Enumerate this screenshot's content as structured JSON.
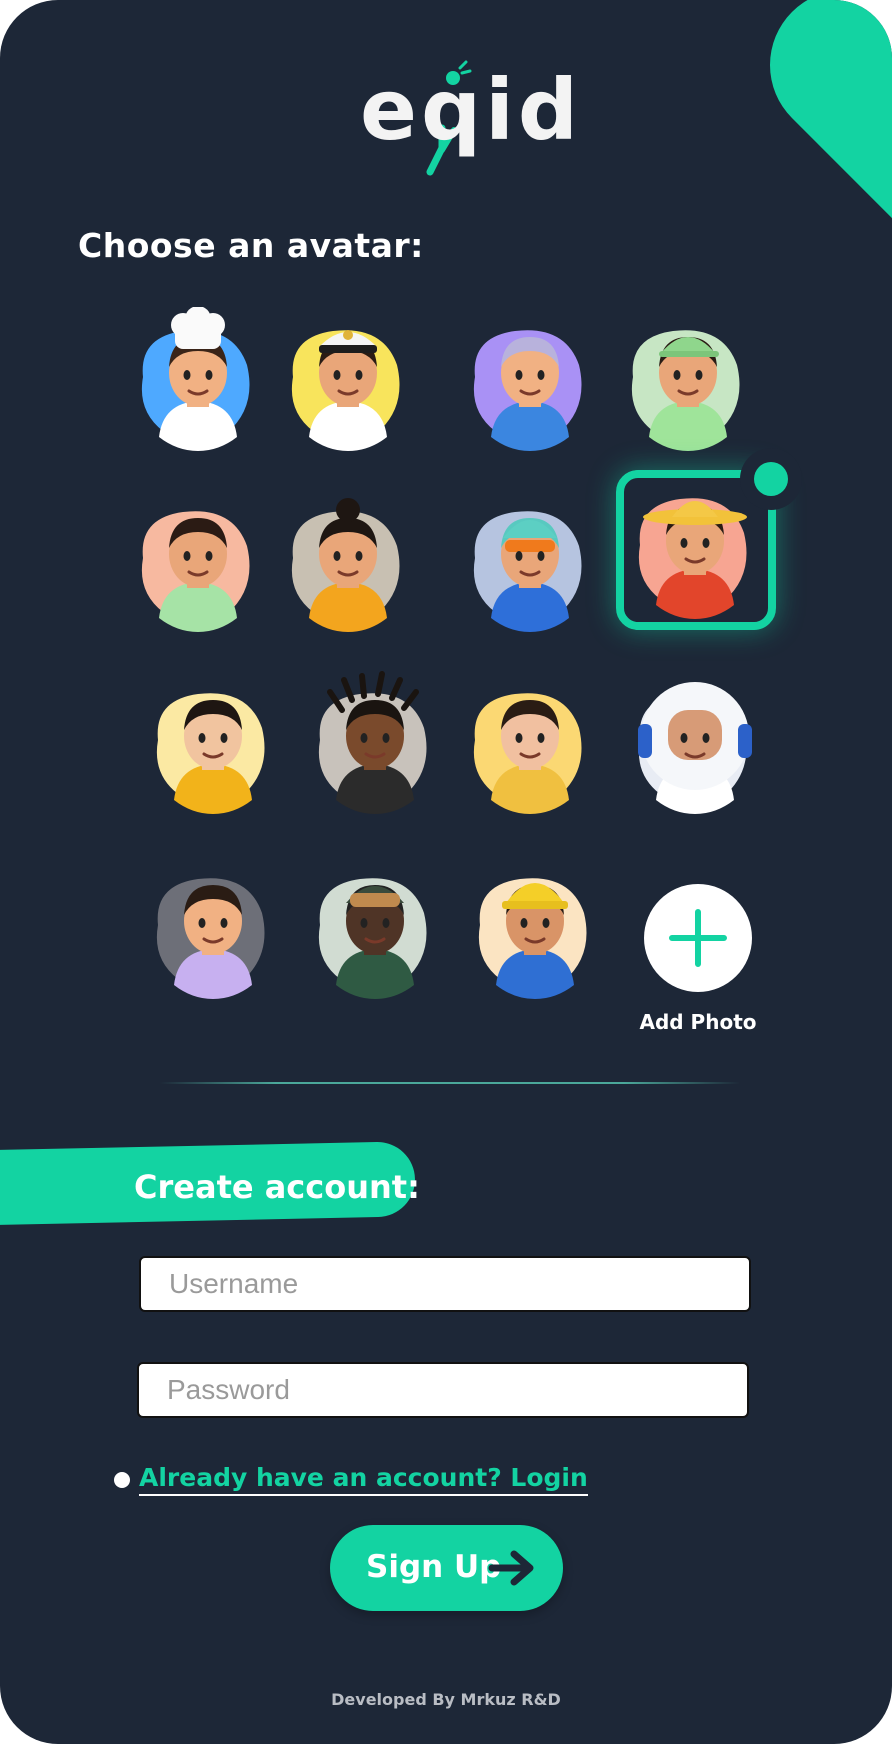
{
  "app": {
    "logo_text": "eqid"
  },
  "avatar_section": {
    "heading": "Choose an avatar:",
    "avatars": [
      {
        "name": "chef",
        "bg": "#4ea9ff",
        "skin": "#f1b183",
        "shirt": "#ffffff",
        "hair": "#3a2418",
        "hat": "chef-hat"
      },
      {
        "name": "pilot",
        "bg": "#f8e45c",
        "skin": "#e9a679",
        "shirt": "#ffffff",
        "hair": "#2a1c14",
        "hat": "captain-cap"
      },
      {
        "name": "doctor",
        "bg": "#a991f5",
        "skin": "#f1b183",
        "shirt": "#3b86e0",
        "hair": "#b8b2dc",
        "hat": "none"
      },
      {
        "name": "coach",
        "bg": "#c7e6c4",
        "skin": "#e9a679",
        "shirt": "#9fe49a",
        "hair": "#2a1c14",
        "hat": "green-cap"
      },
      {
        "name": "boy",
        "bg": "#f7b9a0",
        "skin": "#e9a679",
        "shirt": "#a6e3a6",
        "hair": "#2b1b14",
        "hat": "none"
      },
      {
        "name": "girl",
        "bg": "#c8c0b2",
        "skin": "#e9a679",
        "shirt": "#f3a51e",
        "hair": "#1e1612",
        "hat": "bun"
      },
      {
        "name": "hoodie-guy",
        "bg": "#b6c4e0",
        "skin": "#e9a679",
        "shirt": "#2e6fd9",
        "hair": "#58c9c0",
        "hat": "beanie"
      },
      {
        "name": "farmer",
        "bg": "#f7a592",
        "skin": "#e9a679",
        "shirt": "#e2452b",
        "hair": "#2a1c14",
        "hat": "straw-hat"
      },
      {
        "name": "reporter",
        "bg": "#fbe9a3",
        "skin": "#f1c49f",
        "shirt": "#f2b31a",
        "hair": "#1e1612",
        "hat": "none"
      },
      {
        "name": "dreadlocks",
        "bg": "#c8c2bb",
        "skin": "#7a4a2c",
        "shirt": "#2b2b2b",
        "hair": "#1a1410",
        "hat": "dreads"
      },
      {
        "name": "businessman",
        "bg": "#fbd873",
        "skin": "#f1c0a0",
        "shirt": "#f0c040",
        "hair": "#2a1c14",
        "hat": "none"
      },
      {
        "name": "astronaut",
        "bg": "#e8ecf4",
        "skin": "#d79b77",
        "shirt": "#ffffff",
        "hair": "#ffffff",
        "hat": "helmet"
      },
      {
        "name": "waiter",
        "bg": "#6d6f78",
        "skin": "#f1b183",
        "shirt": "#c7b0f0",
        "hair": "#2a1c14",
        "hat": "none"
      },
      {
        "name": "soldier",
        "bg": "#d1dcd2",
        "skin": "#4f3426",
        "shirt": "#2f5a43",
        "hair": "#222",
        "hat": "goggles"
      },
      {
        "name": "builder",
        "bg": "#fbe4c2",
        "skin": "#d99467",
        "shirt": "#2f6fd3",
        "hair": "#2a1c14",
        "hat": "hard-hat"
      }
    ],
    "selected_index": 7,
    "add_photo_label": "Add Photo"
  },
  "account_section": {
    "heading": "Create account:",
    "username_placeholder": "Username",
    "password_placeholder": "Password",
    "login_link": "Already have an account? Login",
    "signup_label": "Sign Up"
  },
  "footer": {
    "text": "Developed By Mrkuz R&D"
  },
  "colors": {
    "accent": "#13d3a2",
    "background": "#1d2737"
  }
}
